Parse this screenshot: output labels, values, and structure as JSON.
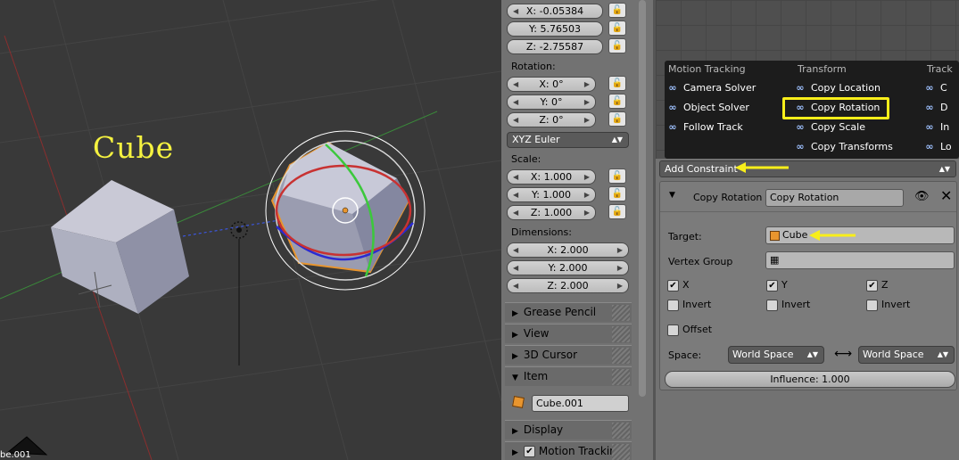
{
  "viewport": {
    "annotation": "Cube",
    "corner_label": "be.001"
  },
  "npanel": {
    "location": {
      "x": "X: -0.05384",
      "y": "Y: 5.76503",
      "z": "Z: -2.75587"
    },
    "rotation_label": "Rotation:",
    "rotation": {
      "x": "X: 0°",
      "y": "Y: 0°",
      "z": "Z: 0°"
    },
    "rotation_mode": "XYZ Euler",
    "scale_label": "Scale:",
    "scale": {
      "x": "X: 1.000",
      "y": "Y: 1.000",
      "z": "Z: 1.000"
    },
    "dimensions_label": "Dimensions:",
    "dimensions": {
      "x": "X: 2.000",
      "y": "Y: 2.000",
      "z": "Z: 2.000"
    },
    "sections": {
      "grease_pencil": "Grease Pencil",
      "view": "View",
      "cursor": "3D Cursor",
      "item": "Item",
      "display": "Display",
      "motion_tracking": "Motion Tracking"
    },
    "item_name": "Cube.001"
  },
  "menu": {
    "col1_head": "Motion Tracking",
    "col1": [
      "Camera Solver",
      "Object Solver",
      "Follow Track"
    ],
    "col2_head": "Transform",
    "col2": [
      "Copy Location",
      "Copy Rotation",
      "Copy Scale",
      "Copy Transforms"
    ],
    "col3_head": "Track",
    "col3": [
      "C",
      "D",
      "In",
      "Lo"
    ]
  },
  "constraints": {
    "add_constraint": "Add Constraint",
    "type_label": "Copy Rotation",
    "name_value": "Copy Rotation",
    "target_label": "Target:",
    "target_value": "Cube",
    "vertex_group_label": "Vertex Group",
    "axes": [
      "X",
      "Y",
      "Z"
    ],
    "invert_label": "Invert",
    "offset_label": "Offset",
    "space_label": "Space:",
    "space_owner": "World Space",
    "space_target": "World Space",
    "influence": "Influence: 1.000"
  },
  "colors": {
    "annotation_yellow": "#f8ee1a",
    "x_axis": "#c83232",
    "y_axis": "#3cc83c",
    "z_axis": "#2a2ad2",
    "selection_orange": "#e8952e"
  }
}
